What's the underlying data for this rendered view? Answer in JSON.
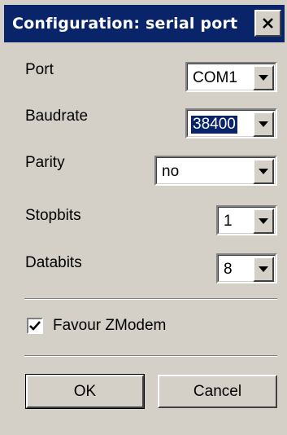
{
  "dialog": {
    "title": "Configuration: serial port",
    "close_glyph": "X"
  },
  "fields": {
    "port": {
      "label": "Port",
      "value": "COM1"
    },
    "baudrate": {
      "label": "Baudrate",
      "value": "38400"
    },
    "parity": {
      "label": "Parity",
      "value": "no"
    },
    "stopbits": {
      "label": "Stopbits",
      "value": "1"
    },
    "databits": {
      "label": "Databits",
      "value": "8"
    }
  },
  "favour_zmodem": {
    "label": "Favour ZModem",
    "checked": true
  },
  "buttons": {
    "ok": "OK",
    "cancel": "Cancel"
  },
  "colors": {
    "titlebar": "#0a246a",
    "face": "#d4d0c8",
    "selection": "#0a246a"
  },
  "icons": {
    "close": "close-icon",
    "dropdown": "chevron-down-icon",
    "check": "checkmark-icon"
  }
}
